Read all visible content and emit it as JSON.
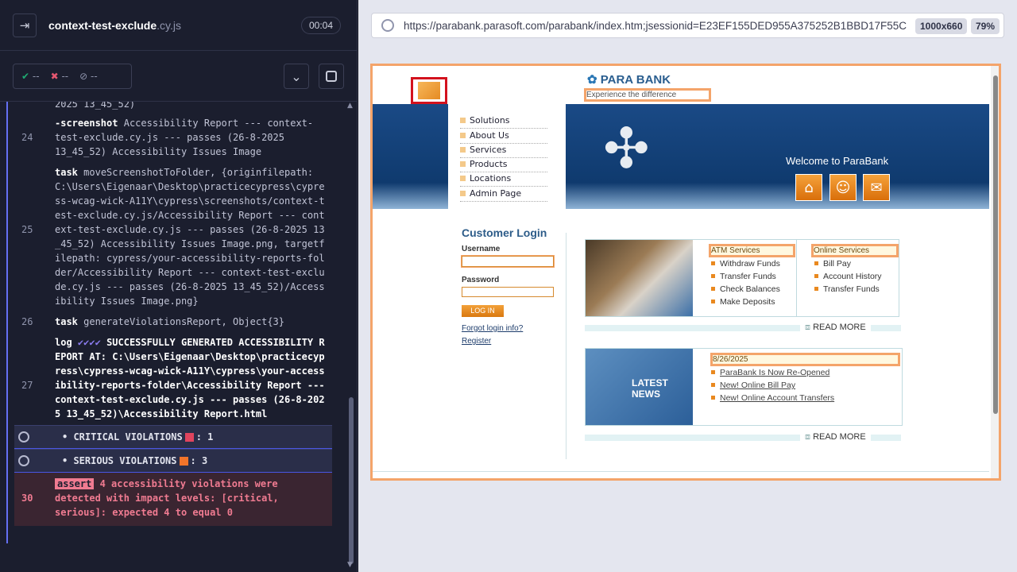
{
  "runner": {
    "spec_name": "context-test-exclude",
    "spec_ext": ".cy.js",
    "timer": "00:04",
    "passed": "--",
    "failed": "--",
    "pending": "--"
  },
  "log": {
    "prev_tail": "2025 13_45_52)",
    "row24": {
      "num": "24",
      "cmd": "-screenshot",
      "text": "Accessibility Report --- context-test-exclude.cy.js --- passes (26-8-2025 13_45_52) Accessibility Issues Image"
    },
    "row25": {
      "num": "25",
      "cmd": "task",
      "text": "moveScreenshotToFolder, {originfilepath: C:\\Users\\Eigenaar\\Desktop\\practicecypress\\cypress-wcag-wick-A11Y\\cypress\\screenshots/context-test-exclude.cy.js/Accessibility Report --- context-test-exclude.cy.js --- passes (26-8-2025 13_45_52) Accessibility Issues Image.png, targetfilepath: cypress/your-accessibility-reports-folder/Accessibility Report --- context-test-exclude.cy.js --- passes (26-8-2025 13_45_52)/Accessibility Issues Image.png}"
    },
    "row26": {
      "num": "26",
      "cmd": "task",
      "text": "generateViolationsReport, Object{3}"
    },
    "row27": {
      "num": "27",
      "cmd": "log",
      "checks": "✔✔✔✔",
      "text": "SUCCESSFULLY GENERATED ACCESSIBILITY REPORT AT: C:\\Users\\Eigenaar\\Desktop\\practicecypress\\cypress-wcag-wick-A11Y\\cypress\\your-accessibility-reports-folder\\Accessibility Report --- context-test-exclude.cy.js --- passes (26-8-2025 13_45_52)\\Accessibility Report.html"
    },
    "critical": {
      "label": "• CRITICAL VIOLATIONS",
      "count": ": 1",
      "color": "#e0445e"
    },
    "serious": {
      "label": "• SERIOUS VIOLATIONS",
      "count": ": 3",
      "color": "#f2742a"
    },
    "row30": {
      "num": "30",
      "badge": "assert",
      "text": "4 accessibility violations were detected with impact levels: [critical, serious]: expected 4 to equal 0"
    }
  },
  "browser": {
    "url": "https://parabank.parasoft.com/parabank/index.htm;jsessionid=E23EF155DED955A375252B1BBD17F55C",
    "viewport": "1000x660",
    "zoom": "79%"
  },
  "parabank": {
    "logo": "PARA BANK",
    "tagline": "Experience the difference",
    "nav": [
      "Solutions",
      "About Us",
      "Services",
      "Products",
      "Locations",
      "Admin Page"
    ],
    "welcome": "Welcome to ParaBank",
    "login_title": "Customer Login",
    "username_label": "Username",
    "password_label": "Password",
    "login_btn": "LOG IN",
    "forgot": "Forgot login info?",
    "register": "Register",
    "atm_title": "ATM Services",
    "atm_items": [
      "Withdraw Funds",
      "Transfer Funds",
      "Check Balances",
      "Make Deposits"
    ],
    "online_title": "Online Services",
    "online_items": [
      "Bill Pay",
      "Account History",
      "Transfer Funds"
    ],
    "read_more": "READ MORE",
    "latest_news": "LATEST NEWS",
    "news_date": "8/26/2025",
    "news_items": [
      "ParaBank Is Now Re-Opened",
      "New! Online Bill Pay",
      "New! Online Account Transfers"
    ]
  }
}
